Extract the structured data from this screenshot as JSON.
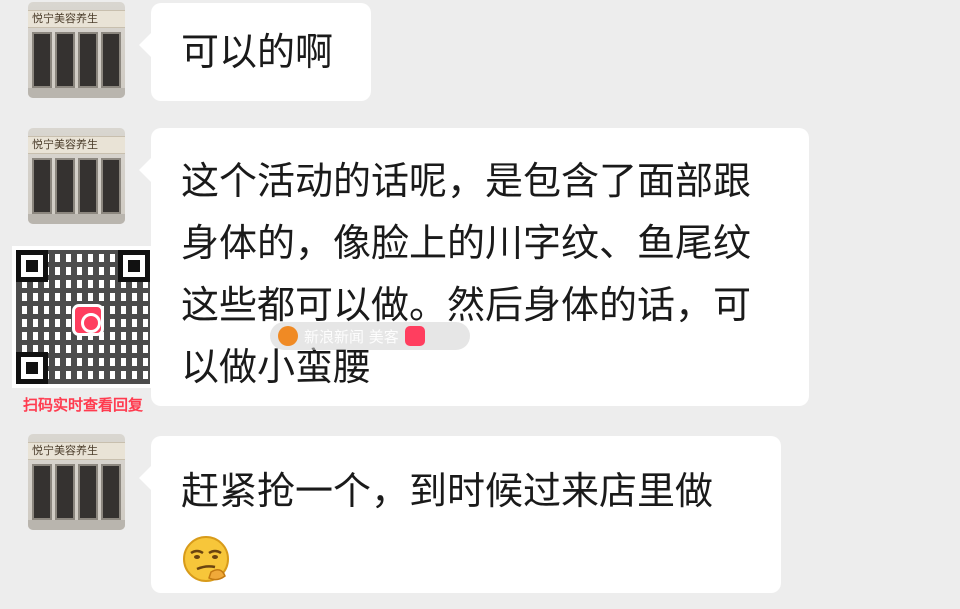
{
  "contact": {
    "avatar_sign": "悦宁美容养生",
    "avatar_icon": "storefront-photo"
  },
  "messages": [
    {
      "text": "可以的啊"
    },
    {
      "text": "这个活动的话呢，是包含了面部跟身体的，像脸上的川字纹、鱼尾纹这些都可以做。然后身体的话，可以做小蛮腰"
    },
    {
      "text": "赶紧抢一个，到时候过来店里做",
      "emoji": "smirk-emoji"
    }
  ],
  "qr_overlay": {
    "caption": "扫码实时查看回复",
    "icon": "qr-code",
    "accent": "#ff3b4f"
  },
  "watermark": {
    "text": "新浪新闻 美客"
  },
  "colors": {
    "background": "#ededed",
    "bubble": "#ffffff",
    "text": "#1a1a1a"
  }
}
